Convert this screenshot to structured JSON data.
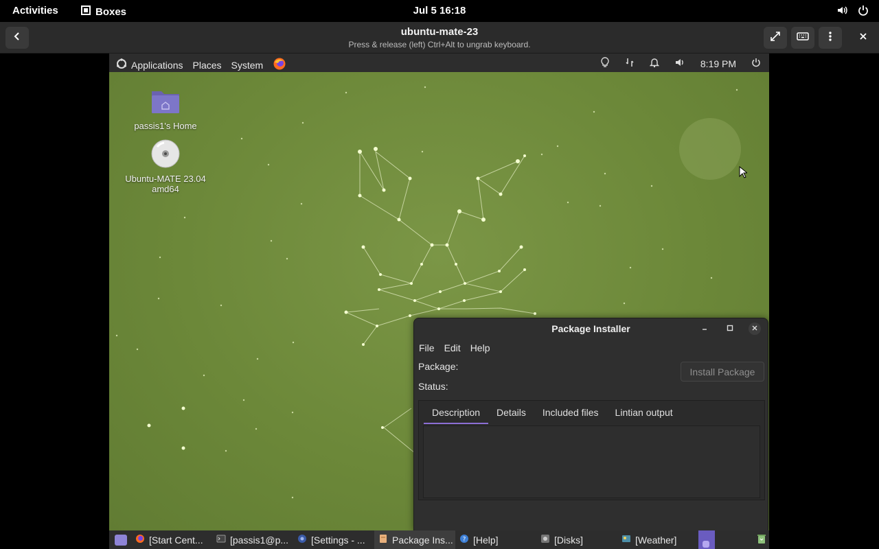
{
  "gnome": {
    "activities": "Activities",
    "app_name": "Boxes",
    "clock": "Jul 5  16:18"
  },
  "boxes": {
    "title": "ubuntu-mate-23",
    "subtitle": "Press & release (left) Ctrl+Alt to ungrab keyboard."
  },
  "vm_panel": {
    "menus": [
      "Applications",
      "Places",
      "System"
    ],
    "time": "8:19 PM"
  },
  "desktop": {
    "icons": [
      {
        "label": "passis1's Home"
      },
      {
        "label_line1": "Ubuntu-MATE 23.04",
        "label_line2": "amd64"
      }
    ]
  },
  "package_installer": {
    "title": "Package Installer",
    "menu": [
      "File",
      "Edit",
      "Help"
    ],
    "package_label": "Package:",
    "status_label": "Status:",
    "install_button": "Install Package",
    "tabs": [
      "Description",
      "Details",
      "Included files",
      "Lintian output"
    ],
    "active_tab": "Description"
  },
  "taskbar": {
    "items": [
      "[Start Cent...",
      "[passis1@p...",
      "[Settings - ...",
      "Package Ins...",
      "[Help]",
      "[Disks]",
      "[Weather]"
    ]
  },
  "colors": {
    "accent": "#8c6fd6",
    "desktop_green": "#6f8a3e",
    "panel": "#2d2d2d"
  }
}
